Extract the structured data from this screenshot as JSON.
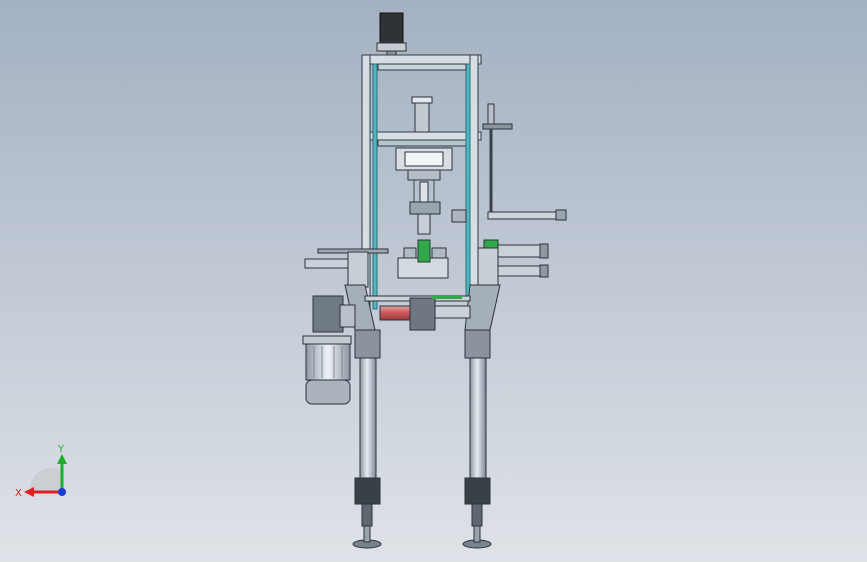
{
  "viewport": {
    "background_top": "#a3b1c3",
    "background_bottom": "#dfe3e8",
    "frame_color": "#4fb7c4",
    "accent_green": "#2fa84a",
    "accent_red": "#c85a5a"
  },
  "triad": {
    "x_label": "X",
    "y_label": "Y",
    "x_color": "#e02020",
    "y_color": "#1fae2b",
    "z_color": "#1a3cd6"
  }
}
